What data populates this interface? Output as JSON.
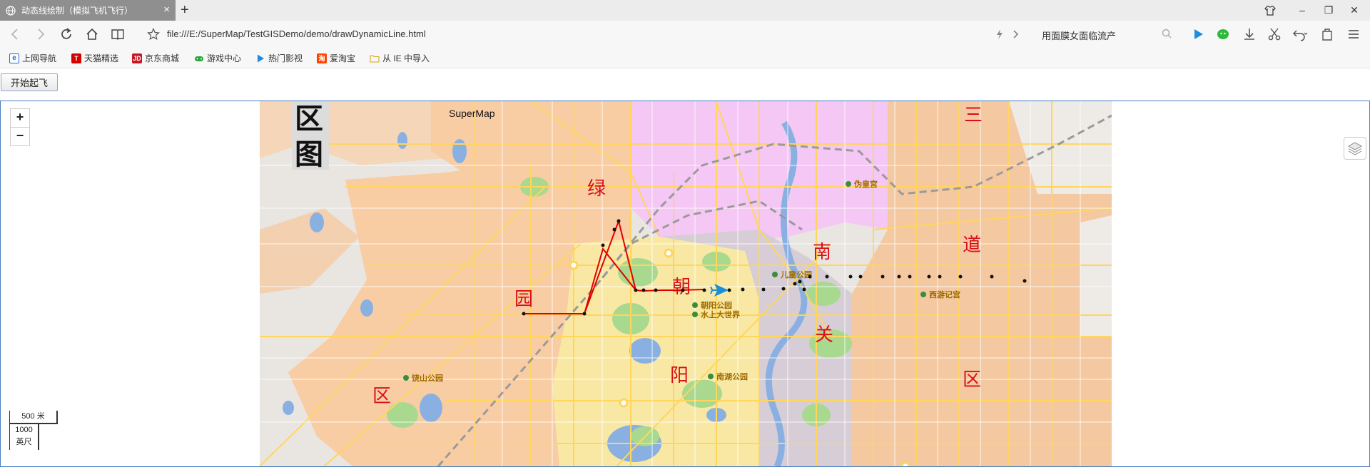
{
  "tab": {
    "title": "动态线绘制（模拟飞机飞行）",
    "close": "×",
    "new_tab": "+"
  },
  "window": {
    "minimize": "–",
    "restore": "❐",
    "close": "✕"
  },
  "address": {
    "url": "file:///E:/SuperMap/TestGISDemo/demo/drawDynamicLine.html"
  },
  "search": {
    "value": "用面膜女面临流产"
  },
  "bookmarks": [
    {
      "label": "上网导航",
      "icon": "ie-icon",
      "color": "#1e6fd1"
    },
    {
      "label": "天猫精选",
      "icon": "tmall-icon",
      "color": "#d40000"
    },
    {
      "label": "京东商城",
      "icon": "jd-icon",
      "color": "#c81623"
    },
    {
      "label": "游戏中心",
      "icon": "gamepad-icon",
      "color": "#2aa53a"
    },
    {
      "label": "热门影视",
      "icon": "play-icon",
      "color": "#1e88e5"
    },
    {
      "label": "爱淘宝",
      "icon": "taobao-icon",
      "color": "#ff4400"
    },
    {
      "label": "从 IE 中导入",
      "icon": "folder-icon",
      "color": "#e7b53a"
    }
  ],
  "page": {
    "start_button": "开始起飞"
  },
  "map": {
    "brand": "SuperMap",
    "zoom_in": "+",
    "zoom_out": "−",
    "scale_metric": "500 米",
    "scale_imperial_value": "1000",
    "scale_imperial_unit": "英尺",
    "labels": {
      "qu_top": "区",
      "tu": "图",
      "san": "三",
      "lv": "绿",
      "nan": "南",
      "dao": "道",
      "yuan": "园",
      "chao": "朝",
      "guan": "关",
      "yang": "阳",
      "qu_right": "区",
      "qu_bottom": "区"
    },
    "pois": {
      "palace": "伪皇宫",
      "children_park": "儿童公园",
      "chaoyang_park": "朝阳公园",
      "water_world": "水上大世界",
      "xiyouji": "西游记宫",
      "nanhu_park": "南湖公园",
      "panshan_park": "饶山公园"
    },
    "colors": {
      "commercial": "#f9cda4",
      "purple_district": "#f4c7f4",
      "yellow_district": "#f9e8a3",
      "gray_district": "#d6cdd6",
      "water": "#8ab0e2",
      "green": "#a8d98e",
      "road": "#ffd65b",
      "flight_path": "#e00000",
      "plane": "#1a8fd8"
    }
  }
}
